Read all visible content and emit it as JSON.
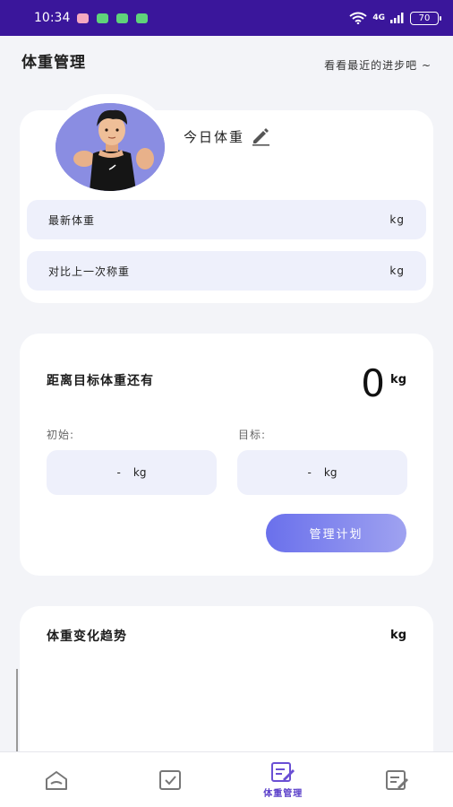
{
  "status_bar": {
    "time": "10:34",
    "network": "4G",
    "battery": "70",
    "notification_colors": [
      "#f5a8c0",
      "#5fd37a",
      "#5fd37a",
      "#5fd37a"
    ]
  },
  "header": {
    "title": "体重管理",
    "subtitle": "看看最近的进步吧 ~"
  },
  "today_card": {
    "today_label": "今日体重",
    "rows": [
      {
        "label": "最新体重",
        "unit": "kg"
      },
      {
        "label": "对比上一次称重",
        "unit": "kg"
      }
    ]
  },
  "goal_card": {
    "label": "距离目标体重还有",
    "value": "0",
    "unit": "kg",
    "start_label": "初始:",
    "start_value": "-",
    "start_unit": "kg",
    "target_label": "目标:",
    "target_value": "-",
    "target_unit": "kg",
    "plan_button": "管理计划"
  },
  "trend_card": {
    "title": "体重变化趋势",
    "unit": "kg"
  },
  "tabbar": {
    "tabs": [
      {
        "icon": "home-icon",
        "label": ""
      },
      {
        "icon": "checkbox-icon",
        "label": ""
      },
      {
        "icon": "edit-note-icon",
        "label": "体重管理",
        "active": true
      },
      {
        "icon": "note-edit-icon",
        "label": ""
      }
    ]
  },
  "colors": {
    "status_bar": "#3a169b",
    "accent": "#6a70ec",
    "pill_bg": "#eef0fb",
    "active_tab": "#5a3ec9"
  }
}
